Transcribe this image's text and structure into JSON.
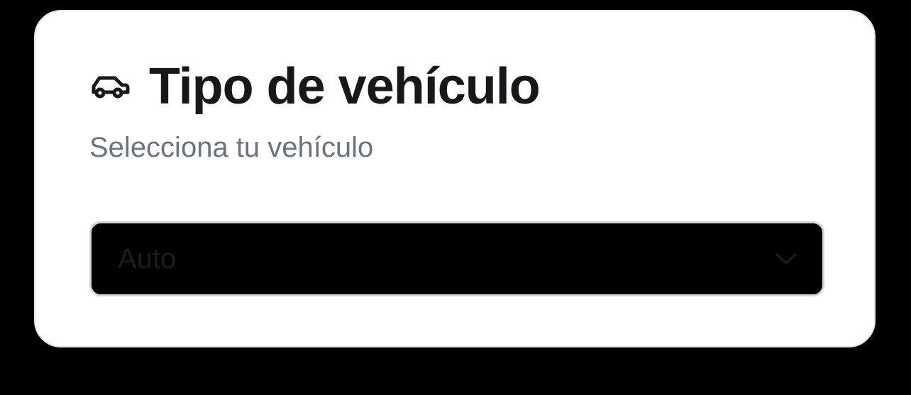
{
  "card": {
    "icon": "car-icon",
    "title": "Tipo de vehículo",
    "subtitle": "Selecciona tu vehículo"
  },
  "vehicle_select": {
    "selected_value": "Auto",
    "icon": "chevron-down-icon"
  },
  "colors": {
    "page_background": "#000000",
    "card_background": "#ffffff",
    "title_text": "#18181b",
    "subtitle_text": "#6b7280",
    "select_background": "#000000",
    "select_border": "#d4d4d8",
    "select_text": "#1c1c1c"
  }
}
